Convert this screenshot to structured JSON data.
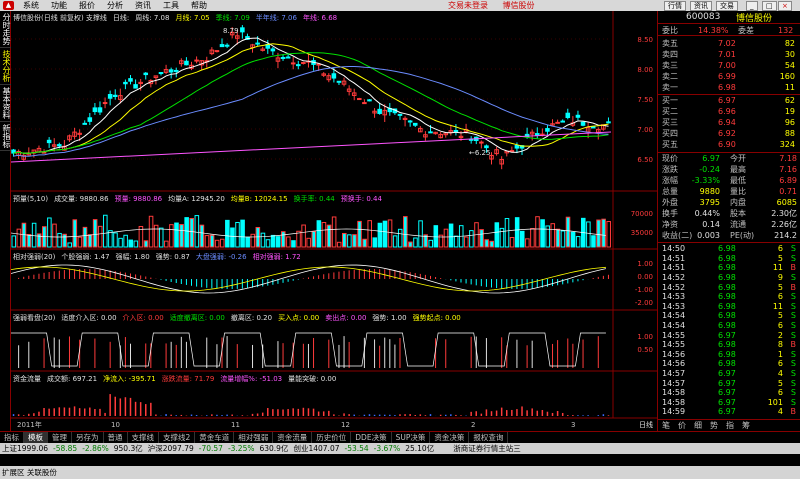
{
  "menu": {
    "items": [
      "系统",
      "功能",
      "报价",
      "分析",
      "资讯",
      "工具",
      "帮助"
    ],
    "center": [
      "交易未登录",
      "博信股份"
    ],
    "right": [
      "行情",
      "资讯",
      "交易"
    ]
  },
  "sidebar": {
    "tabs": [
      "分时走势",
      "技术分析",
      "基本资料",
      "新指标"
    ]
  },
  "main": {
    "info_line": [
      "博信股份(日线 前复权) 支撑线",
      "日线:",
      "周线: 7.08",
      "月线: 7.05",
      "季线: 7.09",
      "半年线: 7.06",
      "年线: 6.68"
    ],
    "price_scale": [
      "8.50",
      "8.00",
      "7.50",
      "7.00",
      "6.50"
    ],
    "high_marker": "8.79",
    "low_marker": "6.25",
    "vol_info": [
      "预量(5,10)",
      "成交量: 9880.86",
      "预量: 9880.86",
      "均量A: 12945.20",
      "均量B: 12024.15",
      "换手率: 0.44",
      "预换手: 0.44"
    ],
    "vol_scale": [
      "70000",
      "35000"
    ],
    "rel_info": [
      "相对强弱(20)",
      "个股强弱: 1.47",
      "强幅: 1.80",
      "强势: 0.87",
      "大盘强弱: -0.26",
      "相对强弱: 1.72"
    ],
    "rel_scale": [
      "1.00",
      "0.00",
      "-1.00",
      "-2.00"
    ],
    "watch_info": [
      "强弱看盘(20)",
      "适度介入区: 0.00",
      "介入区: 0.00",
      "适度撤离区: 0.00",
      "撤离区: 0.20",
      "买入点: 0.00",
      "卖出点: 0.00",
      "强势: 1.00",
      "强势起点: 0.00"
    ],
    "watch_scale": [
      "1.00",
      "0.50"
    ],
    "flow_info": [
      "资金流量",
      "成交额: 697.21",
      "净流入: -395.71",
      "涨跌流量: 71.79",
      "流量增幅%: -51.03",
      "量能突破: 0.00"
    ],
    "dates": [
      "2011年",
      "10",
      "11",
      "12",
      "2",
      "3"
    ],
    "period_label": "日线"
  },
  "right": {
    "code": "600083",
    "name": "博信股份",
    "weibi_label": "委比",
    "weibi": "14.38%",
    "weicha_label": "委差",
    "weicha": "132",
    "sell": [
      [
        "卖五",
        "7.02",
        "82"
      ],
      [
        "卖四",
        "7.01",
        "30"
      ],
      [
        "卖三",
        "7.00",
        "54"
      ],
      [
        "卖二",
        "6.99",
        "160"
      ],
      [
        "卖一",
        "6.98",
        "11"
      ]
    ],
    "buy": [
      [
        "买一",
        "6.97",
        "62"
      ],
      [
        "买二",
        "6.96",
        "19"
      ],
      [
        "买三",
        "6.94",
        "96"
      ],
      [
        "买四",
        "6.92",
        "88"
      ],
      [
        "买五",
        "6.90",
        "324"
      ]
    ],
    "stats": [
      [
        "现价",
        "6.97",
        "今开",
        "7.18"
      ],
      [
        "涨跌",
        "-0.24",
        "最高",
        "7.16"
      ],
      [
        "涨幅",
        "-3.33%",
        "最低",
        "6.89"
      ],
      [
        "总量",
        "9880",
        "量比",
        "0.71"
      ],
      [
        "外盘",
        "3795",
        "内盘",
        "6085"
      ],
      [
        "换手",
        "0.44%",
        "股本",
        "2.30亿"
      ],
      [
        "净资",
        "0.14",
        "流通",
        "2.26亿"
      ],
      [
        "收益(二)",
        "0.003",
        "PE(动)",
        "214.2"
      ]
    ],
    "ticks": [
      [
        "14:50",
        "6.98",
        "6",
        "S"
      ],
      [
        "14:51",
        "6.98",
        "5",
        "S"
      ],
      [
        "14:51",
        "6.98",
        "11",
        "B"
      ],
      [
        "14:52",
        "6.98",
        "9",
        "S"
      ],
      [
        "14:52",
        "6.98",
        "5",
        "B"
      ],
      [
        "14:53",
        "6.98",
        "6",
        "S"
      ],
      [
        "14:53",
        "6.98",
        "11",
        "S"
      ],
      [
        "14:54",
        "6.98",
        "5",
        "S"
      ],
      [
        "14:54",
        "6.98",
        "6",
        "S"
      ],
      [
        "14:55",
        "6.97",
        "2",
        "S"
      ],
      [
        "14:55",
        "6.98",
        "8",
        "B"
      ],
      [
        "14:56",
        "6.98",
        "1",
        "S"
      ],
      [
        "14:56",
        "6.98",
        "6",
        "S"
      ],
      [
        "14:57",
        "6.97",
        "4",
        "S"
      ],
      [
        "14:57",
        "6.97",
        "5",
        "S"
      ],
      [
        "14:58",
        "6.97",
        "6",
        "S"
      ],
      [
        "14:58",
        "6.97",
        "101",
        "S"
      ],
      [
        "14:59",
        "6.97",
        "4",
        "B"
      ]
    ],
    "tabs": [
      "笔",
      "价",
      "细",
      "势",
      "指",
      "筹"
    ]
  },
  "toolbar": {
    "items": [
      "指标",
      "模板",
      "管理",
      "另存为",
      "普通",
      "支撑线",
      "支撑线2",
      "黄金车道",
      "相对强弱",
      "资金流量",
      "历史价位",
      "DDE决策",
      "SUP决策",
      "资金决策",
      "报权查询"
    ]
  },
  "statusbar": {
    "items": [
      "上证1999.06",
      "-58.85",
      "-2.86%",
      "950.3亿",
      "沪深2097.79",
      "-70.57",
      "-3.25%",
      "630.9亿",
      "创业1407.07",
      "-53.54",
      "-3.67%",
      "25.10亿"
    ],
    "server": "浙商证券行情主站三"
  },
  "statusbar2": {
    "text": "扩展区  关联股份"
  },
  "colors": {
    "up": "#ff3b3b",
    "down": "#00e000",
    "cyan": "#00ffff",
    "bg": "#000000"
  }
}
